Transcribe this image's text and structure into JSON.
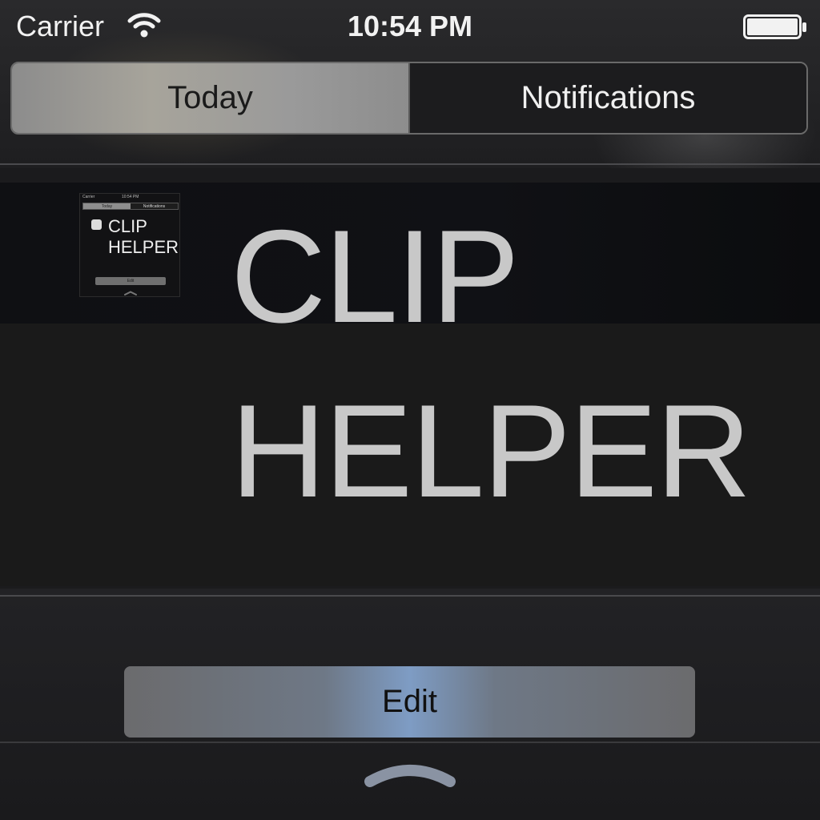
{
  "status_bar": {
    "carrier": "Carrier",
    "time": "10:54 PM"
  },
  "segmented_control": {
    "tabs": [
      {
        "label": "Today",
        "selected": true
      },
      {
        "label": "Notifications",
        "selected": false
      }
    ]
  },
  "widget": {
    "title_line1": "CLIP",
    "title_line2": "HELPER",
    "thumbnail": {
      "carrier": "Carrier",
      "time": "10:54 PM",
      "tabs": [
        "Today",
        "Notifications"
      ],
      "title_line1": "CLIP",
      "title_line2": "HELPER",
      "edit_label": "Edit"
    }
  },
  "footer": {
    "edit_label": "Edit"
  },
  "icons": {
    "wifi": "wifi-icon",
    "battery": "battery-icon",
    "grabber": "chevron-up-icon"
  },
  "colors": {
    "accent_glow": "#4a90d9",
    "title_text": "#c8c8c8"
  }
}
